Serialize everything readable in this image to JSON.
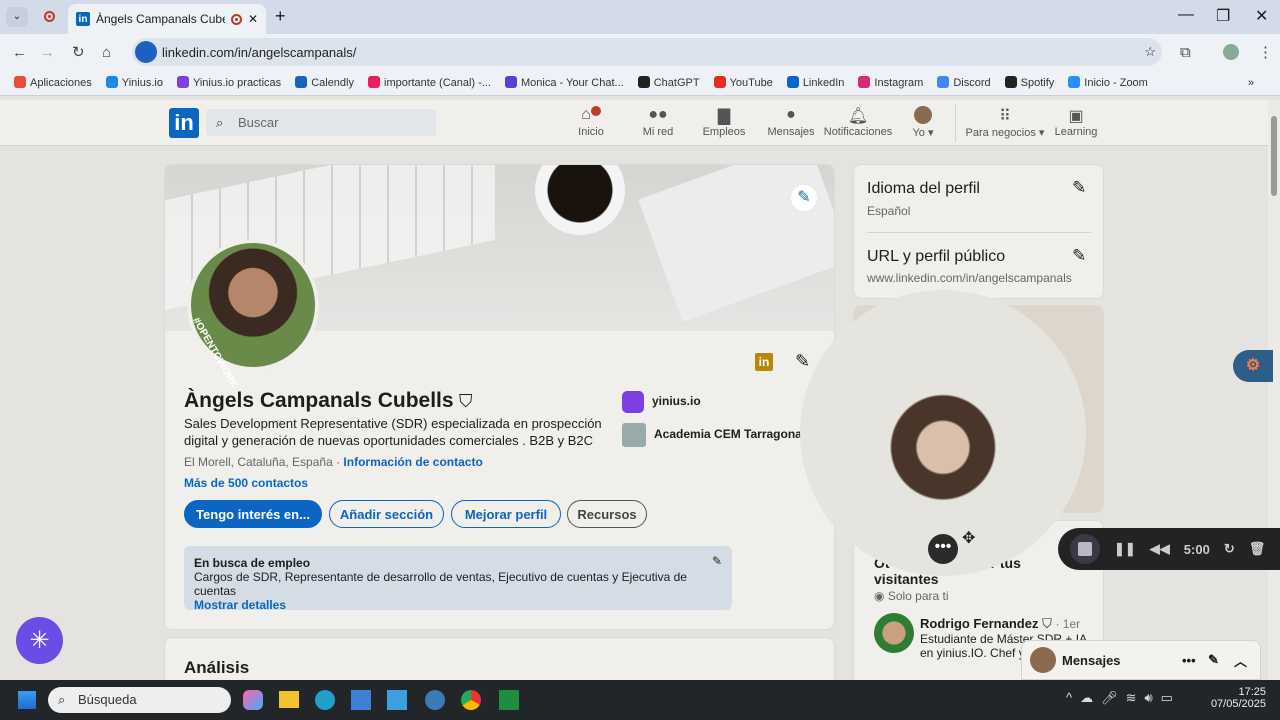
{
  "browser": {
    "tab_title": "Àngels Campanals Cubells |",
    "url": "linkedin.com/in/angelscampanals/",
    "bookmarks": [
      "Aplicaciones",
      "Yinius.io",
      "Yinius.io practicas",
      "Calendly",
      "importante (Canal) -...",
      "Monica - Your Chat...",
      "ChatGPT",
      "YouTube",
      "LinkedIn",
      "Instagram",
      "Discord",
      "Spotify",
      "Inicio - Zoom"
    ],
    "bookmark_colors": [
      "#e74c3c",
      "#1e88e5",
      "#7b3fe4",
      "#1565c0",
      "#e91e63",
      "#5c3dd8",
      "#222222",
      "#e52d27",
      "#0a66c2",
      "#d62976",
      "#4285f4",
      "#222222",
      "#2d8cff"
    ]
  },
  "nav": {
    "search_placeholder": "Buscar",
    "items": [
      "Inicio",
      "Mi red",
      "Empleos",
      "Mensajes",
      "Notificaciones",
      "Yo",
      "Para negocios",
      "Learning"
    ],
    "notification_badge": "1"
  },
  "profile": {
    "name": "Àngels Campanals Cubells",
    "headline": "Sales Development Representative (SDR) especializada en prospección digital y generación de nuevas oportunidades comerciales . B2B y B2C",
    "location": "El Morell, Cataluña, España ·",
    "contact_link": "Información de contacto",
    "connections": "Más de 500 contactos",
    "opentowork": "#OPENTOWORK",
    "companies": [
      "yinius.io",
      "Academia CEM Tarragona"
    ],
    "buttons": [
      "Tengo interés en...",
      "Añadir sección",
      "Mejorar perfil",
      "Recursos"
    ],
    "open_to_work": {
      "title": "En busca de empleo",
      "text": "Cargos de SDR, Representante de desarrollo de ventas, Ejecutivo de cuentas y Ejecutiva de cuentas",
      "link": "Mostrar detalles"
    },
    "analysis_title": "Análisis"
  },
  "sidebar": {
    "lang_title": "Idioma del perfil",
    "lang_value": "Español",
    "url_title": "URL y perfil público",
    "url_value": "www.linkedin.com/in/angelscampanals",
    "viewers_title_a": "Ot",
    "viewers_title_b": "por tus",
    "viewers_title_c": "visitantes",
    "viewers_privacy": "Solo para ti",
    "person": {
      "name": "Rodrigo Fernandez",
      "degree": "· 1er",
      "desc_1": "Estudiante de Máster SDR + IA",
      "desc_2": "en yinius.IO. Chef y"
    }
  },
  "recorder": {
    "time": "5:00"
  },
  "messages": {
    "label": "Mensajes"
  },
  "taskbar": {
    "search": "Búsqueda",
    "time": "17:25",
    "date": "07/05/2025"
  },
  "accent": "#0a66c2"
}
